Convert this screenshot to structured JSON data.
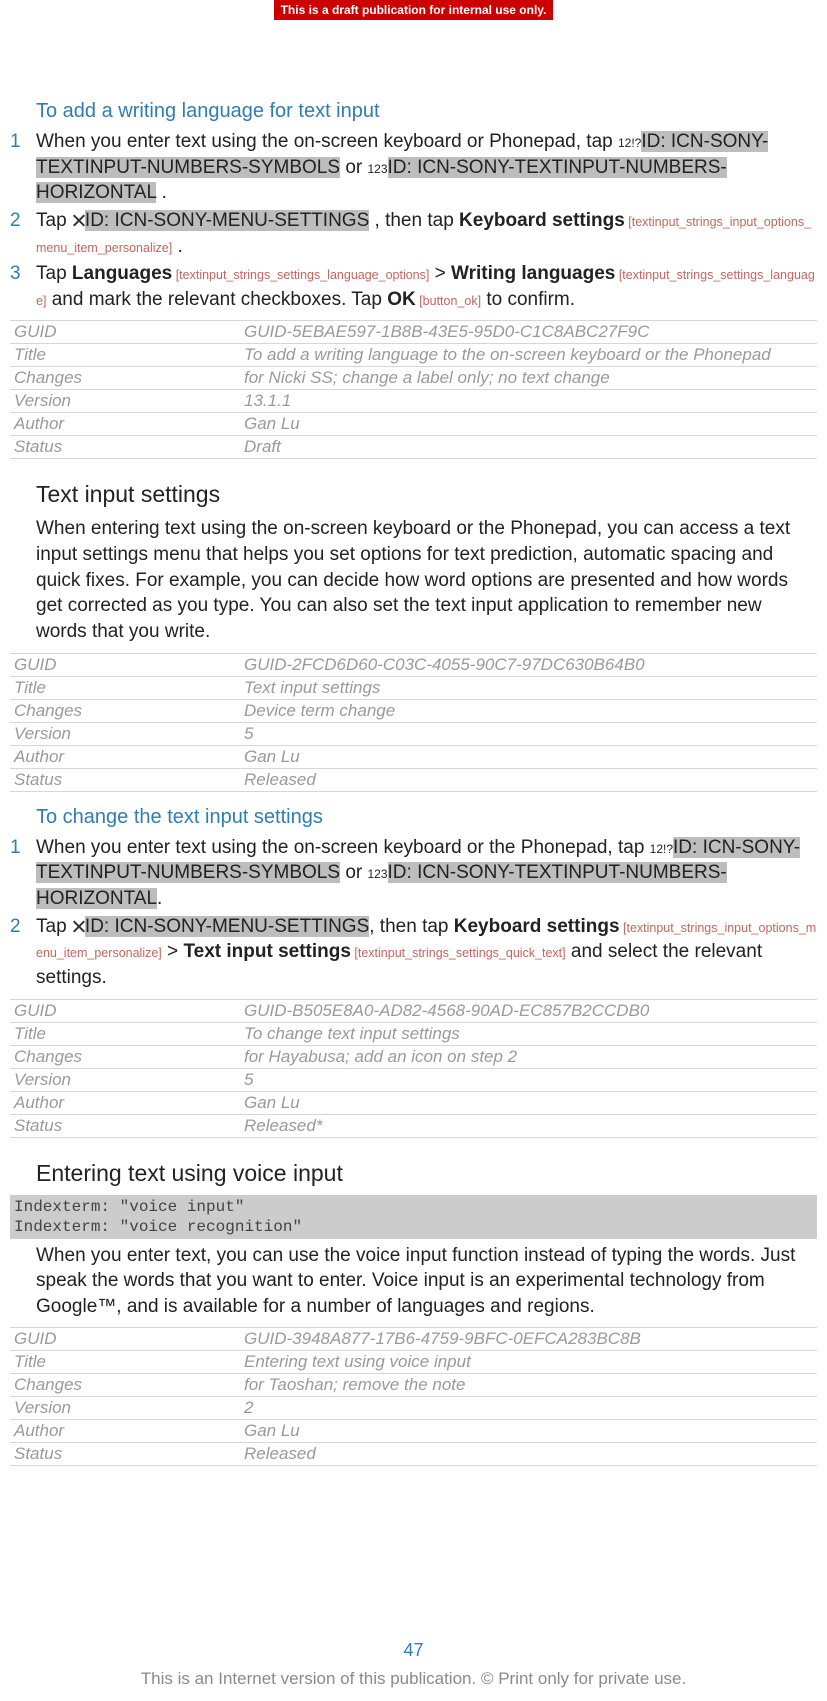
{
  "banner": "This is a draft publication for internal use only.",
  "section1": {
    "heading": "To add a writing language for text input",
    "step1_a": "When you enter text using the on-screen keyboard or Phonepad, tap ",
    "step1_icon1": "12!?",
    "step1_id1": "ID: ICN-SONY-TEXTINPUT-NUMBERS-SYMBOLS",
    "step1_or": " or ",
    "step1_icon2": "123",
    "step1_id2": "ID: ICN-SONY-TEXTINPUT-NUMBERS-HORIZONTAL",
    "step1_end": " .",
    "step2_a": "Tap ",
    "step2_id": "ID: ICN-SONY-MENU-SETTINGS",
    "step2_b": " , then tap ",
    "step2_bold": "Keyboard settings",
    "step2_ref": " [textinput_strings_input_options_menu_item_personalize]",
    "step2_end": " .",
    "step3_a": "Tap ",
    "step3_bold1": "Languages",
    "step3_ref1": " [textinput_strings_settings_language_options]",
    "step3_gt": " > ",
    "step3_bold2": "Writing languages",
    "step3_ref2": " [textinput_strings_settings_language]",
    "step3_b": " and mark the relevant checkboxes. Tap ",
    "step3_bold3": "OK",
    "step3_ref3": " [button_ok]",
    "step3_end": " to confirm."
  },
  "meta1": {
    "guid": "GUID-5EBAE597-1B8B-43E5-95D0-C1C8ABC27F9C",
    "title": "To add a writing language to the on-screen keyboard or the Phonepad",
    "changes": "for Nicki SS; change a label only; no text change",
    "version": "13.1.1",
    "author": "Gan Lu",
    "status": "Draft"
  },
  "section2": {
    "heading": "Text input settings",
    "para": "When entering text using the on-screen keyboard or the Phonepad, you can access a text input settings menu that helps you set options for text prediction, automatic spacing and quick fixes. For example, you can decide how word options are presented and how words get corrected as you type. You can also set the text input application to remember new words that you write."
  },
  "meta2": {
    "guid": "GUID-2FCD6D60-C03C-4055-90C7-97DC630B64B0",
    "title": "Text input settings",
    "changes": "Device term change",
    "version": "5",
    "author": "Gan Lu",
    "status": "Released"
  },
  "section3": {
    "heading": "To change the text input settings",
    "step1_a": "When you enter text using the on-screen keyboard or the Phonepad, tap ",
    "step1_icon1": "12!?",
    "step1_id1": "ID: ICN-SONY-TEXTINPUT-NUMBERS-SYMBOLS",
    "step1_or": " or ",
    "step1_icon2": "123",
    "step1_id2": "ID: ICN-SONY-TEXTINPUT-NUMBERS-HORIZONTAL",
    "step1_end": ".",
    "step2_a": "Tap ",
    "step2_id": "ID: ICN-SONY-MENU-SETTINGS",
    "step2_b": ", then tap ",
    "step2_bold": "Keyboard settings",
    "step2_ref": " [textinput_strings_input_options_menu_item_personalize]",
    "step2_gt": " > ",
    "step2_bold2": "Text input settings",
    "step2_ref2": " [textinput_strings_settings_quick_text]",
    "step2_end": " and select the relevant settings."
  },
  "meta3": {
    "guid": "GUID-B505E8A0-AD82-4568-90AD-EC857B2CCDB0",
    "title": "To change text input settings",
    "changes": "for Hayabusa; add an icon on step 2",
    "version": "5",
    "author": "Gan Lu",
    "status": "Released*"
  },
  "section4": {
    "heading": "Entering text using voice input",
    "index1": "Indexterm: \"voice input\"",
    "index2": "Indexterm: \"voice recognition\"",
    "para": "When you enter text, you can use the voice input function instead of typing the words. Just speak the words that you want to enter. Voice input is an experimental technology from Google™, and is available for a number of languages and regions."
  },
  "meta4": {
    "guid": "GUID-3948A877-17B6-4759-9BFC-0EFCA283BC8B",
    "title": "Entering text using voice input",
    "changes": "for Taoshan; remove the note",
    "version": "2",
    "author": "Gan Lu",
    "status": "Released"
  },
  "labels": {
    "guid": "GUID",
    "title": "Title",
    "changes": "Changes",
    "version": "Version",
    "author": "Author",
    "status": "Status"
  },
  "page_num": "47",
  "footer": "This is an Internet version of this publication. © Print only for private use."
}
